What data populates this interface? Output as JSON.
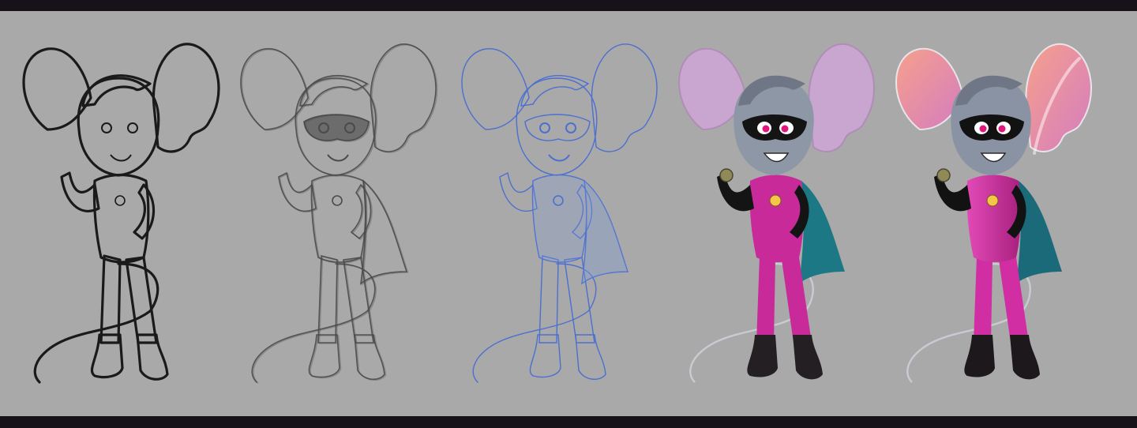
{
  "sheet": {
    "border_color": "#17121a",
    "background_color": "#a9a9a9",
    "panels": [
      {
        "id": "rough-sketch",
        "style": "rough",
        "icon": "mouse-hero-rough-sketch",
        "ink": "#1a1a1a"
      },
      {
        "id": "tight-pencil",
        "style": "pencil",
        "icon": "mouse-hero-tight-pencil",
        "ink": "#4a4a4a"
      },
      {
        "id": "blue-line",
        "style": "blueline",
        "icon": "mouse-hero-blue-line",
        "ink": "#4c6fd0"
      },
      {
        "id": "flat-color",
        "style": "flat",
        "icon": "mouse-hero-flat-color",
        "colors": {
          "suit": "#c82a9a",
          "cape": "#1d7886",
          "fur": "#8e97a6",
          "ear": "#c8a6cf",
          "mask": "#141414",
          "boot": "#231f22",
          "eye": "#e0167c"
        }
      },
      {
        "id": "final-render",
        "style": "rendered",
        "icon": "mouse-hero-final-render",
        "colors": {
          "suit": "#d02ea2",
          "cape": "#1a6a7a",
          "fur": "#8a93a3",
          "ear_inner": "#f29a8e",
          "ear_outer": "#d77fb8",
          "mask": "#121212",
          "boot": "#1c181b",
          "eye": "#e0167c"
        }
      }
    ]
  }
}
